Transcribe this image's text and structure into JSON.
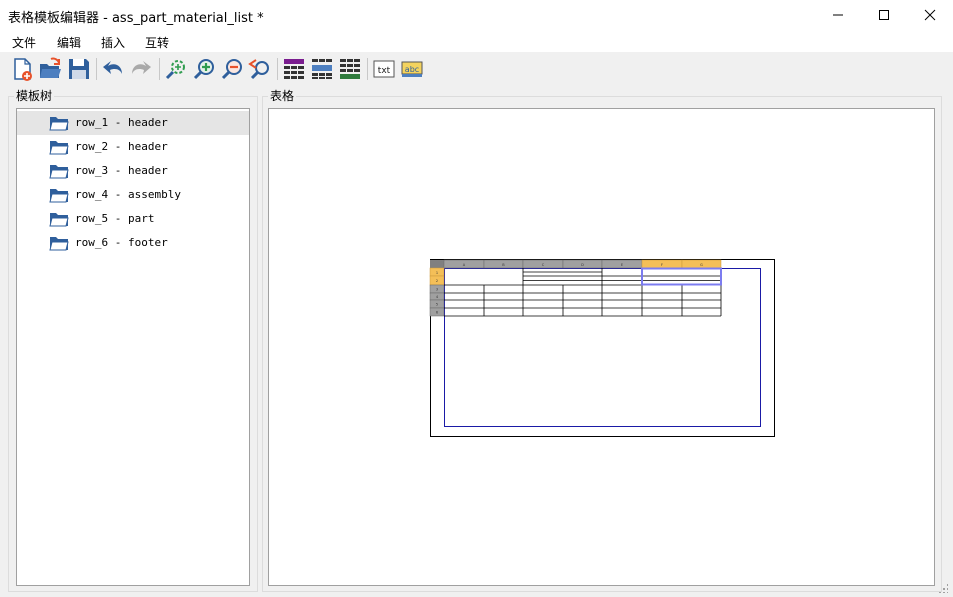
{
  "window": {
    "title": "表格模板编辑器 - ass_part_material_list *"
  },
  "menu": [
    "文件",
    "编辑",
    "插入",
    "互转"
  ],
  "toolbar": {
    "buttons": [
      "new-file-icon",
      "open-folder-icon",
      "save-icon",
      "undo-icon",
      "redo-icon",
      "zoom-fit-icon",
      "zoom-in-icon",
      "zoom-out-icon",
      "zoom-reset-icon",
      "insert-header-row-icon",
      "insert-row-icon",
      "insert-footer-row-icon",
      "text-txt-icon",
      "text-abc-icon"
    ]
  },
  "tree_panel": {
    "title": "模板树",
    "items": [
      {
        "label": "row_1 - header",
        "selected": true
      },
      {
        "label": "row_2 - header",
        "selected": false
      },
      {
        "label": "row_3 - header",
        "selected": false
      },
      {
        "label": "row_4 - assembly",
        "selected": false
      },
      {
        "label": "row_5 - part",
        "selected": false
      },
      {
        "label": "row_6 - footer",
        "selected": false
      }
    ]
  },
  "table_panel": {
    "title": "表格",
    "grid": {
      "columns": [
        "A",
        "B",
        "C",
        "D",
        "E",
        "F",
        "G"
      ],
      "rows": [
        "1",
        "2",
        "3",
        "4",
        "5",
        "6"
      ],
      "selected_columns": [
        "F",
        "G"
      ],
      "selected_rows": [
        "1",
        "2"
      ]
    }
  },
  "colors": {
    "header_gray": "#a0a0a0",
    "selection_orange": "#f4bf58",
    "selection_outline": "#7c7cf0",
    "print_area_blue": "#1a1aa6",
    "folder_blue": "#2f5f9c"
  }
}
